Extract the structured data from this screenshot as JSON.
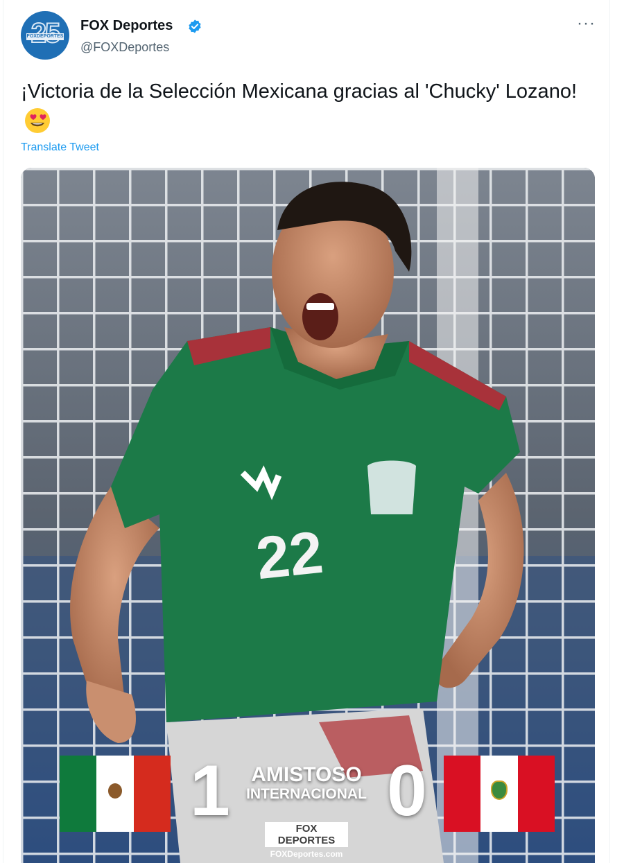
{
  "author": {
    "name": "FOX Deportes",
    "handle": "@FOXDeportes",
    "avatar_text": "25",
    "avatar_logo_text": "FOXDEPORTES",
    "verified": true
  },
  "more_label": "···",
  "tweet": {
    "text": "¡Victoria de la Selección Mexicana gracias al 'Chucky' Lozano!",
    "emoji": "smiling-face-with-heart-eyes",
    "translate_label": "Translate Tweet"
  },
  "media": {
    "player_number": "22",
    "scoreboard": {
      "home_score": "1",
      "away_score": "0",
      "match_type_line1": "AMISTOSO",
      "match_type_line2": "INTERNACIONAL",
      "brand_logo": "FOX DEPORTES",
      "brand_url": "FOXDeportes.com"
    }
  },
  "colors": {
    "link": "#1d9bf0",
    "jersey": "#1c7a48",
    "mexico_green": "#0f7a3c",
    "mexico_red": "#d52b1e",
    "peru_red": "#d91023"
  }
}
